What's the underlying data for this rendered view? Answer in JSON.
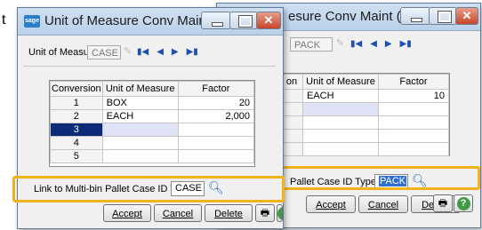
{
  "back_window": {
    "title": "Unit of Measure Conv Maint (A...",
    "title_partial": "esure Conv Maint (A...",
    "uom_value": "PACK",
    "table": {
      "headers": [
        "on",
        "Unit of Measure",
        "Factor"
      ],
      "rows": [
        {
          "uom": "EACH",
          "factor": "10"
        }
      ]
    },
    "link_label": "Pallet Case ID Type",
    "link_value": "PACK",
    "buttons": {
      "accept": "Accept",
      "cancel": "Cancel",
      "delete": "Delete"
    }
  },
  "front_window": {
    "title": "Unit of Measure Conv Maint (A...",
    "uom_label": "Unit of Measure",
    "uom_value": "CASE",
    "table": {
      "headers": [
        "Conversion",
        "Unit of Measure",
        "Factor"
      ],
      "rows": [
        {
          "num": "1",
          "uom": "BOX",
          "factor": "20"
        },
        {
          "num": "2",
          "uom": "EACH",
          "factor": "2,000"
        },
        {
          "num": "3",
          "uom": "",
          "factor": ""
        },
        {
          "num": "4",
          "uom": "",
          "factor": ""
        },
        {
          "num": "5",
          "uom": "",
          "factor": ""
        }
      ]
    },
    "link_label": "Link to Multi-bin Pallet Case ID Type",
    "link_value": "CASE",
    "buttons": {
      "accept": "Accept",
      "cancel": "Cancel",
      "delete": "Delete"
    }
  },
  "colors": {
    "highlight": "#f2b21b",
    "selected_row": "#0b2a7a",
    "accent": "#2f6fd0"
  },
  "icons": [
    "first-record-icon",
    "prev-record-icon",
    "next-record-icon",
    "last-record-icon",
    "search-icon",
    "print-icon",
    "help-icon",
    "close-icon",
    "minimize-icon",
    "maximize-icon"
  ]
}
